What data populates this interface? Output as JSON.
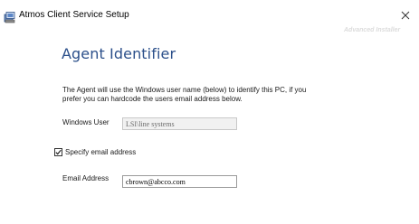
{
  "window": {
    "title": "Atmos Client Service Setup",
    "icon": "installer-icon",
    "close_icon": "close-icon"
  },
  "banner": {
    "tag": "Advanced Installer"
  },
  "page": {
    "heading": "Agent Identifier",
    "description_line1": "The Agent will use the Windows user name (below)  to identify this PC, if you",
    "description_line2": "prefer you can hardcode the users email address  below."
  },
  "form": {
    "windows_user_label": "Windows User",
    "windows_user_value": "LSI\\line systems",
    "specify_email_label": "Specify email address",
    "specify_email_checked": true,
    "email_label": "Email Address",
    "email_value": "cbrown@abcco.com"
  }
}
